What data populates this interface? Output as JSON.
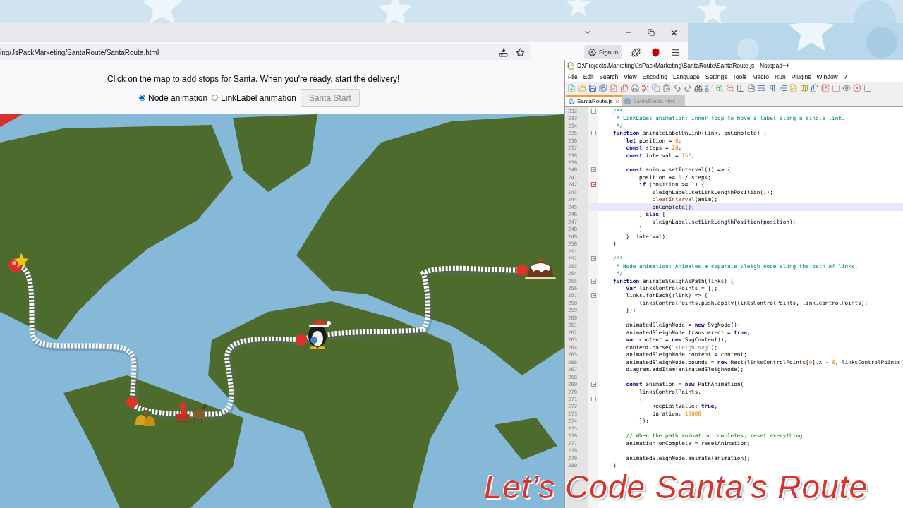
{
  "browser": {
    "url": "ing/JsPackMarketing/SantaRoute/SantaRoute.html",
    "sign_in": "Sign in"
  },
  "page": {
    "instructions": "Click on the map to add stops for Santa. When you're ready, start the delivery!",
    "modes": [
      {
        "label": "Node animation",
        "selected": true
      },
      {
        "label": "LinkLabel animation",
        "selected": false
      }
    ],
    "start_button": {
      "label": "Santa Start",
      "disabled": true
    }
  },
  "editor": {
    "title": "D:\\Projects\\Marketing\\JsPackMarketing\\SantaRoute\\SantaRoute.js - Notepad++",
    "menu": [
      "File",
      "Edit",
      "Search",
      "View",
      "Encoding",
      "Language",
      "Settings",
      "Tools",
      "Macro",
      "Run",
      "Plugins",
      "Window",
      "?"
    ],
    "tabs": [
      {
        "label": "SantaRoute.js",
        "selected": true
      },
      {
        "label": "SantaRoute.html",
        "selected": false
      }
    ],
    "lines": [
      {
        "number": "232",
        "fold": true,
        "selected": false,
        "parts": [
          {
            "kind": "doc",
            "text": "/**"
          }
        ]
      },
      {
        "number": "233",
        "selected": false,
        "parts": [
          {
            "kind": "doc",
            "text": " * LinkLabel animation: Inner loop to move a label along a single link."
          }
        ]
      },
      {
        "number": "234",
        "selected": false,
        "parts": [
          {
            "kind": "doc",
            "text": " */"
          }
        ]
      },
      {
        "number": "235",
        "fold": true,
        "selected": false,
        "parts": [
          {
            "kind": "kw",
            "text": "function"
          },
          {
            "kind": "plain",
            "text": " animateLabelOnLink(link, onComplete) {"
          }
        ]
      },
      {
        "number": "236",
        "selected": false,
        "parts": [
          {
            "kind": "kw",
            "text": "    let"
          },
          {
            "kind": "plain",
            "text": " position = "
          },
          {
            "kind": "num",
            "text": "0"
          },
          {
            "kind": "plain",
            "text": ";"
          }
        ]
      },
      {
        "number": "237",
        "selected": false,
        "parts": [
          {
            "kind": "kw",
            "text": "    const"
          },
          {
            "kind": "plain",
            "text": " steps = "
          },
          {
            "kind": "num",
            "text": "20"
          },
          {
            "kind": "plain",
            "text": ";"
          }
        ]
      },
      {
        "number": "238",
        "selected": false,
        "parts": [
          {
            "kind": "kw",
            "text": "    const"
          },
          {
            "kind": "plain",
            "text": " interval = "
          },
          {
            "kind": "num",
            "text": "150"
          },
          {
            "kind": "plain",
            "text": ";"
          }
        ]
      },
      {
        "number": "239",
        "selected": false
      },
      {
        "number": "240",
        "fold": true,
        "selected": false,
        "parts": [
          {
            "kind": "kw",
            "text": "    const"
          },
          {
            "kind": "plain",
            "text": " anim = setInterval(() => {"
          }
        ]
      },
      {
        "number": "241",
        "selected": false,
        "parts": [
          {
            "kind": "plain",
            "text": "        position += "
          },
          {
            "kind": "num",
            "text": "1"
          },
          {
            "kind": "plain",
            "text": " / steps;"
          }
        ]
      },
      {
        "number": "242",
        "fold": true,
        "fold_active": true,
        "selected": false,
        "parts": [
          {
            "kind": "kw",
            "text": "        if"
          },
          {
            "kind": "plain",
            "text": " (position >= "
          },
          {
            "kind": "num",
            "text": "1"
          },
          {
            "kind": "plain",
            "text": ") {"
          }
        ]
      },
      {
        "number": "243",
        "selected": false,
        "parts": [
          {
            "kind": "plain",
            "text": "            sleighLabel.setLinkLengthPosition("
          },
          {
            "kind": "num",
            "text": "1"
          },
          {
            "kind": "plain",
            "text": ");"
          }
        ]
      },
      {
        "number": "244",
        "selected": false,
        "parts": [
          {
            "kind": "fn",
            "text": "            clearInterval"
          },
          {
            "kind": "plain",
            "text": "(anim);"
          }
        ]
      },
      {
        "number": "245",
        "selected": true,
        "parts": [
          {
            "kind": "plain",
            "text": "            onComplete();"
          }
        ]
      },
      {
        "number": "246",
        "selected": false,
        "parts": [
          {
            "kind": "plain",
            "text": "        } "
          },
          {
            "kind": "kw",
            "text": "else"
          },
          {
            "kind": "plain",
            "text": " {"
          }
        ]
      },
      {
        "number": "247",
        "selected": false,
        "parts": [
          {
            "kind": "plain",
            "text": "            sleighLabel.setLinkLengthPosition(position);"
          }
        ]
      },
      {
        "number": "248",
        "selected": false,
        "parts": [
          {
            "kind": "plain",
            "text": "        }"
          }
        ]
      },
      {
        "number": "249",
        "selected": false,
        "parts": [
          {
            "kind": "plain",
            "text": "    }, interval);"
          }
        ]
      },
      {
        "number": "250",
        "selected": false,
        "parts": [
          {
            "kind": "plain",
            "text": "}"
          }
        ]
      },
      {
        "number": "251",
        "selected": false
      },
      {
        "number": "252",
        "fold": true,
        "selected": false,
        "parts": [
          {
            "kind": "doc",
            "text": "/**"
          }
        ]
      },
      {
        "number": "253",
        "selected": false,
        "parts": [
          {
            "kind": "doc",
            "text": " * Node animation: Animates a separate sleigh node along the path of links."
          }
        ]
      },
      {
        "number": "254",
        "selected": false,
        "parts": [
          {
            "kind": "doc",
            "text": " */"
          }
        ]
      },
      {
        "number": "255",
        "fold": true,
        "selected": false,
        "parts": [
          {
            "kind": "kw",
            "text": "function"
          },
          {
            "kind": "plain",
            "text": " animateSleighAsPath(links) {"
          }
        ]
      },
      {
        "number": "256",
        "selected": false,
        "parts": [
          {
            "kind": "kw",
            "text": "    var"
          },
          {
            "kind": "plain",
            "text": " linksControlPoints = [];"
          }
        ]
      },
      {
        "number": "257",
        "fold": true,
        "selected": false,
        "parts": [
          {
            "kind": "plain",
            "text": "    links.forEach((link) => {"
          }
        ]
      },
      {
        "number": "258",
        "selected": false,
        "parts": [
          {
            "kind": "plain",
            "text": "        linksControlPoints.push.apply(linksControlPoints, link.controlPoints);"
          }
        ]
      },
      {
        "number": "259",
        "selected": false,
        "parts": [
          {
            "kind": "plain",
            "text": "    });"
          }
        ]
      },
      {
        "number": "260",
        "selected": false
      },
      {
        "number": "261",
        "selected": false,
        "parts": [
          {
            "kind": "plain",
            "text": "    animatedSleighNode = "
          },
          {
            "kind": "kw",
            "text": "new"
          },
          {
            "kind": "plain",
            "text": " SvgNode();"
          }
        ]
      },
      {
        "number": "262",
        "selected": false,
        "parts": [
          {
            "kind": "plain",
            "text": "    animatedSleighNode.transparent = "
          },
          {
            "kind": "kw",
            "text": "true"
          },
          {
            "kind": "plain",
            "text": ";"
          }
        ]
      },
      {
        "number": "263",
        "selected": false,
        "parts": [
          {
            "kind": "kw",
            "text": "    var"
          },
          {
            "kind": "plain",
            "text": " content = "
          },
          {
            "kind": "kw",
            "text": "new"
          },
          {
            "kind": "plain",
            "text": " SvgContent();"
          }
        ]
      },
      {
        "number": "264",
        "selected": false,
        "parts": [
          {
            "kind": "plain",
            "text": "    content.parse("
          },
          {
            "kind": "str",
            "text": "\"sleigh.svg\""
          },
          {
            "kind": "plain",
            "text": ");"
          }
        ]
      },
      {
        "number": "265",
        "selected": false,
        "parts": [
          {
            "kind": "plain",
            "text": "    animatedSleighNode.content = content;"
          }
        ]
      },
      {
        "number": "266",
        "selected": false,
        "parts": [
          {
            "kind": "plain",
            "text": "    animatedSleighNode.bounds = "
          },
          {
            "kind": "kw",
            "text": "new"
          },
          {
            "kind": "plain",
            "text": " Rect(linksControlPoints["
          },
          {
            "kind": "num",
            "text": "0"
          },
          {
            "kind": "plain",
            "text": "].x - "
          },
          {
            "kind": "num",
            "text": "8"
          },
          {
            "kind": "plain",
            "text": ", linksControlPoints["
          }
        ]
      },
      {
        "number": "267",
        "selected": false,
        "parts": [
          {
            "kind": "plain",
            "text": "    diagram.addItem(animatedSleighNode);"
          }
        ]
      },
      {
        "number": "268",
        "selected": false
      },
      {
        "number": "269",
        "fold": true,
        "selected": false,
        "parts": [
          {
            "kind": "kw",
            "text": "    const"
          },
          {
            "kind": "plain",
            "text": " animation = "
          },
          {
            "kind": "kw",
            "text": "new"
          },
          {
            "kind": "plain",
            "text": " PathAnimation("
          }
        ]
      },
      {
        "number": "270",
        "selected": false,
        "parts": [
          {
            "kind": "plain",
            "text": "        linksControlPoints,"
          }
        ]
      },
      {
        "number": "271",
        "fold": true,
        "selected": false,
        "parts": [
          {
            "kind": "plain",
            "text": "        {"
          }
        ]
      },
      {
        "number": "272",
        "selected": false,
        "parts": [
          {
            "kind": "plain",
            "text": "            keepLastValue: "
          },
          {
            "kind": "kw",
            "text": "true"
          },
          {
            "kind": "plain",
            "text": ","
          }
        ]
      },
      {
        "number": "273",
        "selected": false,
        "parts": [
          {
            "kind": "plain",
            "text": "            duration: "
          },
          {
            "kind": "num",
            "text": "10000"
          }
        ]
      },
      {
        "number": "274",
        "selected": false,
        "parts": [
          {
            "kind": "plain",
            "text": "        });"
          }
        ]
      },
      {
        "number": "275",
        "selected": false
      },
      {
        "number": "276",
        "selected": false,
        "parts": [
          {
            "kind": "comment",
            "text": "    // When the path animation completes, reset everything"
          }
        ]
      },
      {
        "number": "277",
        "selected": false,
        "parts": [
          {
            "kind": "plain",
            "text": "    animation.onComplete = resetAnimation;"
          }
        ]
      },
      {
        "number": "278",
        "selected": false
      },
      {
        "number": "279",
        "selected": false,
        "parts": [
          {
            "kind": "plain",
            "text": "    animatedSleighNode.animate(animation);"
          }
        ]
      },
      {
        "number": "280",
        "selected": false,
        "parts": [
          {
            "kind": "plain",
            "text": "}"
          }
        ]
      }
    ]
  },
  "overlay_title": "Let’s Code Santa’s Route"
}
